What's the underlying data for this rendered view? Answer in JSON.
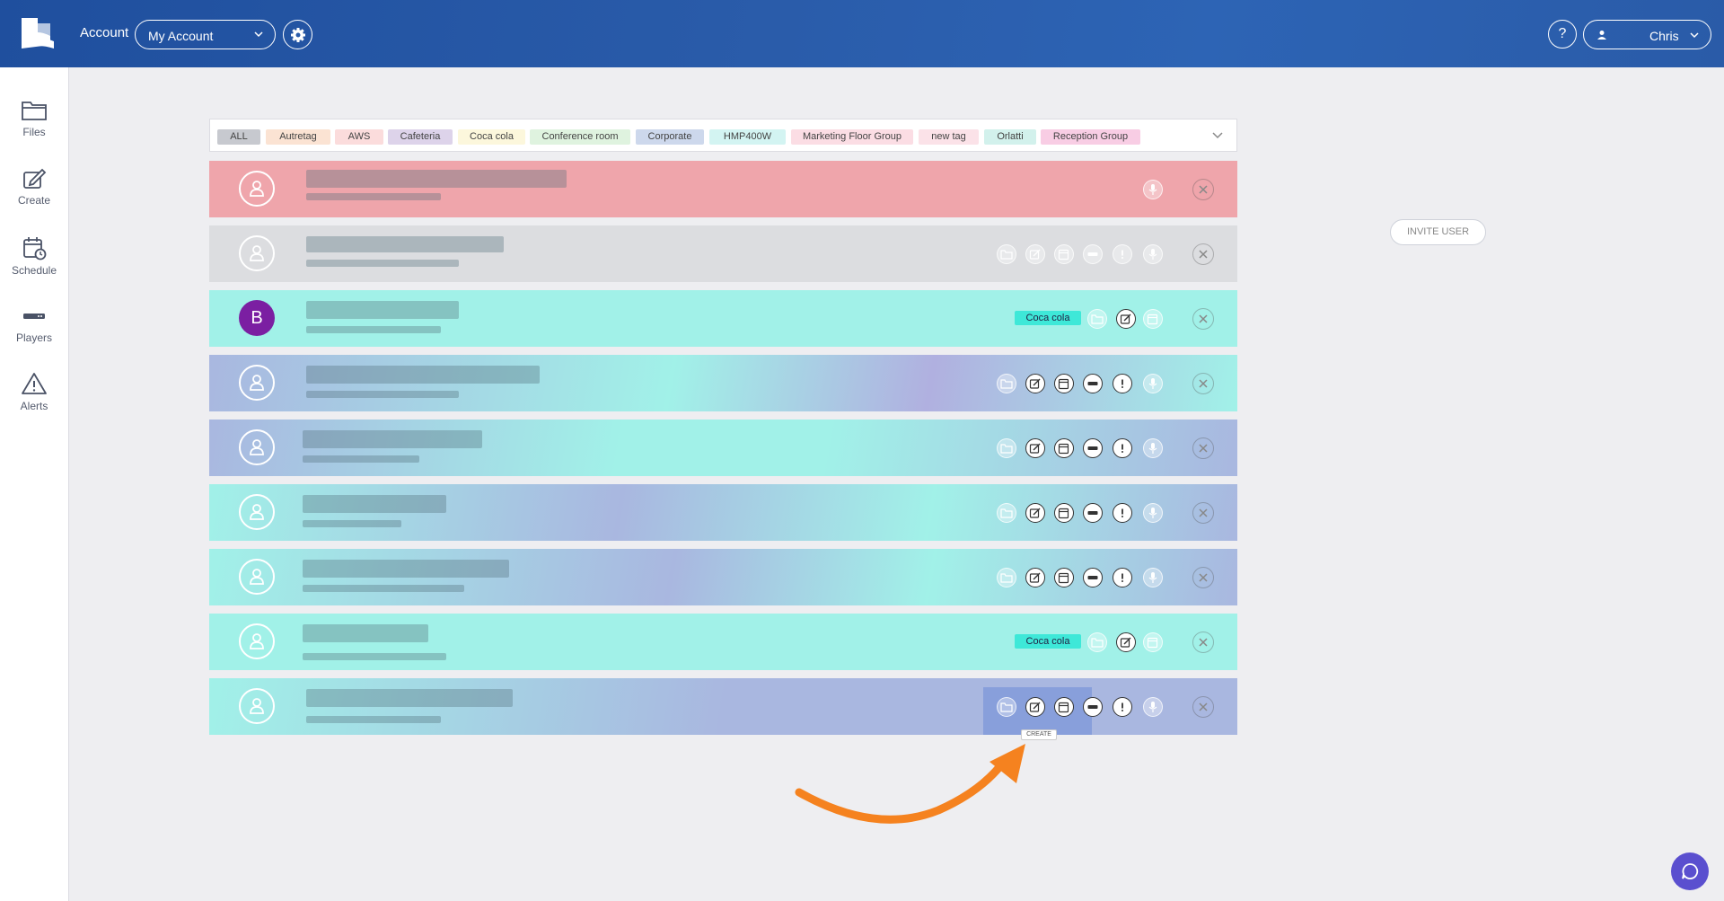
{
  "header": {
    "account_label": "Account",
    "account_select": "My Account",
    "help": "?",
    "user_name": "Chris"
  },
  "sidebar": {
    "items": [
      {
        "label": "Files",
        "icon": "folder-icon"
      },
      {
        "label": "Create",
        "icon": "edit-icon"
      },
      {
        "label": "Schedule",
        "icon": "calendar-icon"
      },
      {
        "label": "Players",
        "icon": "player-device-icon"
      },
      {
        "label": "Alerts",
        "icon": "warning-icon"
      }
    ]
  },
  "tags": [
    {
      "label": "ALL",
      "color": "#c7c9cf"
    },
    {
      "label": "Autretag",
      "color": "#fbe3d3"
    },
    {
      "label": "AWS",
      "color": "#fbdcdc"
    },
    {
      "label": "Cafeteria",
      "color": "#ddd3ea"
    },
    {
      "label": "Coca cola",
      "color": "#fcf7dc"
    },
    {
      "label": "Conference room",
      "color": "#dff3df"
    },
    {
      "label": "Corporate",
      "color": "#cdd8ec"
    },
    {
      "label": "HMP400W",
      "color": "#d3f4f2"
    },
    {
      "label": "Marketing Floor Group",
      "color": "#fbdde4"
    },
    {
      "label": "new tag",
      "color": "#fbe2e8"
    },
    {
      "label": "Orlatti",
      "color": "#d2f1ec"
    },
    {
      "label": "Reception Group",
      "color": "#f8cde4"
    }
  ],
  "rows": [
    {
      "avatar": "",
      "tag": ""
    },
    {
      "avatar": "",
      "tag": ""
    },
    {
      "avatar": "B",
      "tag": "Coca cola"
    },
    {
      "avatar": "",
      "tag": ""
    },
    {
      "avatar": "",
      "tag": ""
    },
    {
      "avatar": "",
      "tag": ""
    },
    {
      "avatar": "",
      "tag": ""
    },
    {
      "avatar": "",
      "tag": "Coca cola"
    },
    {
      "avatar": "",
      "tag": ""
    }
  ],
  "invite_button": "INVITE USER",
  "tooltip": "CREATE",
  "colors": {
    "header": "#2a5caa",
    "row_red": "#efa5ab",
    "row_grey": "#dcdde0",
    "row_teal": "#a1f1e8",
    "row_gradient_purple": "#a9b7e0",
    "chat": "#5a4fcf",
    "arrow": "#f5821f"
  }
}
